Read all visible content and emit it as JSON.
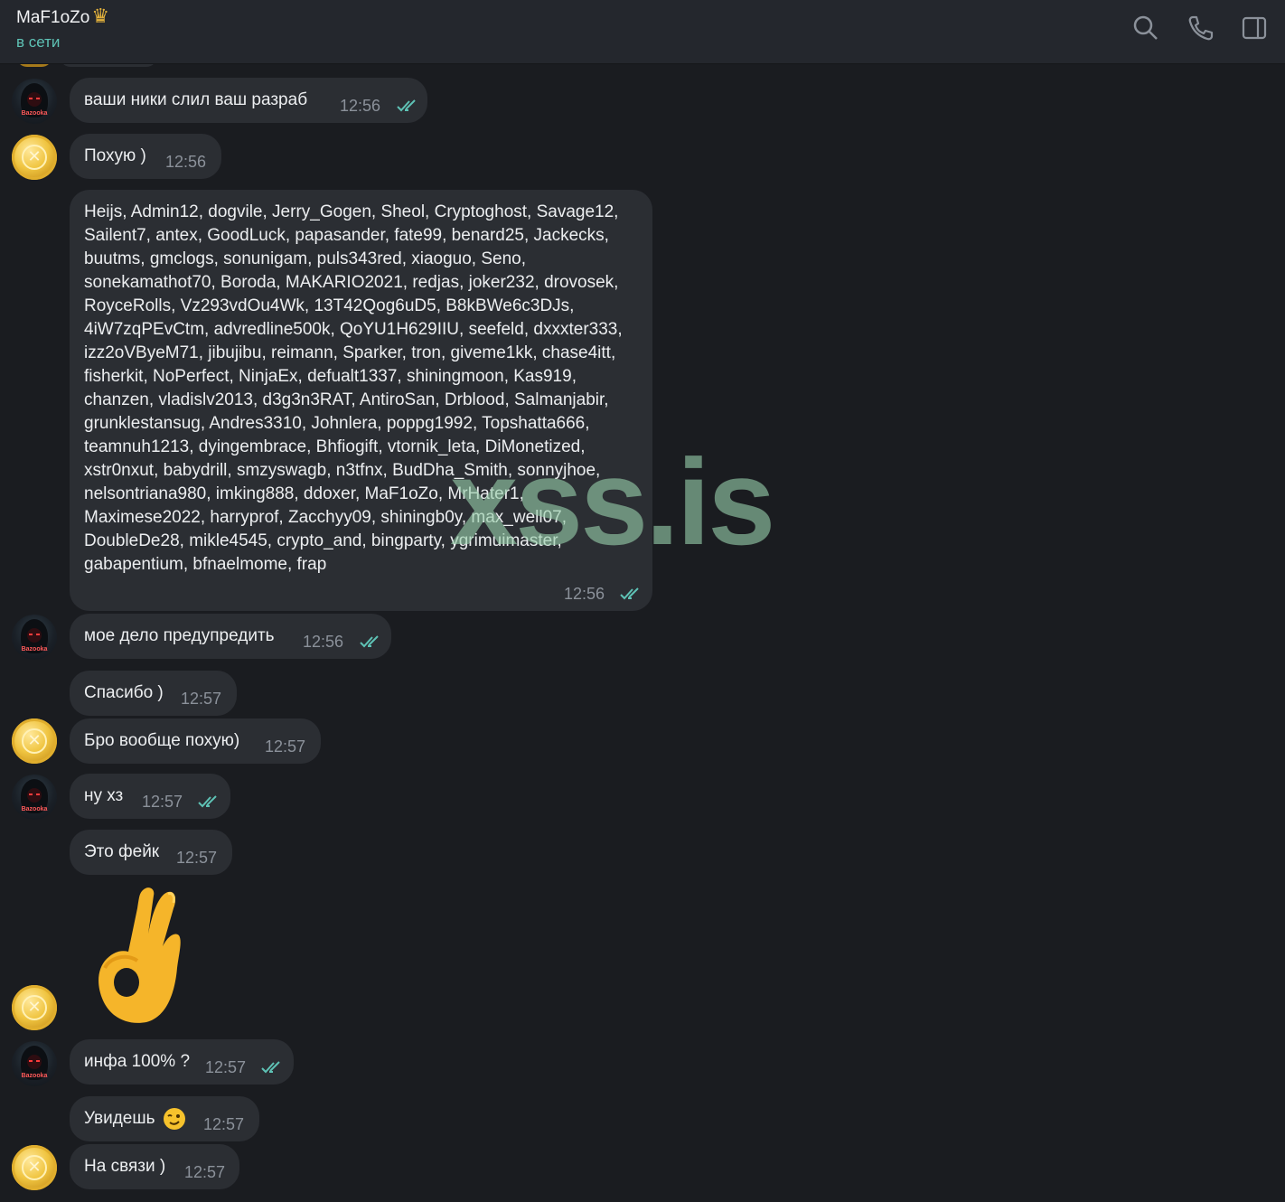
{
  "header": {
    "title": "MaF1oZo",
    "title_emoji": "♛",
    "status": "в сети",
    "icons": [
      "search-icon",
      "phone-icon",
      "sidebar-toggle-icon"
    ]
  },
  "watermark": "xss.is",
  "colors": {
    "status": "#5ec2b5",
    "bubble": "#2b2e33",
    "background": "#1a1c20",
    "check": "#5ec2b5"
  },
  "avatar_label": "Bazooka",
  "messages": [
    {
      "text": "ваши ники слил ваш разраб",
      "time": "12:56",
      "read": true
    },
    {
      "text": "Похую )",
      "time": "12:56"
    },
    {
      "text": "Heijs, Admin12, dogvile, Jerry_Gogen, Sheol, Cryptoghost, Savage12, Sailent7, antex, GoodLuck, papasander, fate99, benard25, Jackecks, buutms, gmclogs, sonunigam, puls343red, xiaoguo, Seno, sonekamathot70, Boroda, MAKARIO2021, redjas, joker232, drovosek, RoyceRolls, Vz293vdOu4Wk, 13T42Qog6uD5, B8kBWe6c3DJs, 4iW7zqPEvCtm, advredline500k, QoYU1H629IIU, seefeld, dxxxter333, izz2oVByeM71, jibujibu, reimann, Sparker, tron, giveme1kk, chase4itt, fisherkit, NoPerfect, NinjaEx, defualt1337, shiningmoon, Kas919, chanzen, vladislv2013, d3g3n3RAT, AntiroSan, Drblood, Salmanjabir, grunklestansug, Andres3310, Johnlera, poppg1992, Topshatta666, teamnuh1213, dyingembrace, Bhfiogift, vtornik_leta, DiMonetized, xstr0nxut, babydrill, smzyswagb, n3tfnx, BudDha_Smith, sonnyjhoe, nelsontriana980, imking888, ddoxer, MaF1oZo, MrHater1, Maximese2022, harryprof, Zacchyy09, shiningb0y, max_well07, DoubleDe28, mikle4545, crypto_and, bingparty, ygrimuimaster, gabapentium, bfnaelmome, frap",
      "time": "12:56",
      "read": true
    },
    {
      "text": "мое дело предупредить",
      "time": "12:56",
      "read": true
    },
    {
      "text": "Спасибо )",
      "time": "12:57"
    },
    {
      "text": "Бро вообще похую)",
      "time": "12:57"
    },
    {
      "text": "ну хз",
      "time": "12:57",
      "read": true
    },
    {
      "text": "Это фейк",
      "time": "12:57"
    },
    {
      "emoji": "ok-hand-emoji"
    },
    {
      "text": "инфа 100% ?",
      "time": "12:57",
      "read": true
    },
    {
      "text": "Увидешь",
      "emoji": "winking-face-emoji",
      "time": "12:57"
    },
    {
      "text": "На связи )",
      "time": "12:57"
    }
  ]
}
